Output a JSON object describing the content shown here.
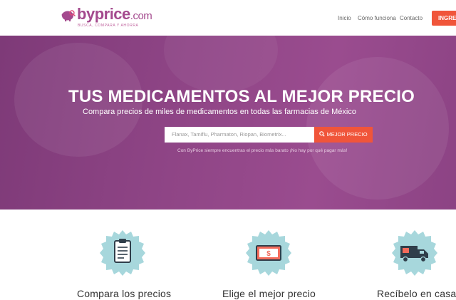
{
  "header": {
    "logo": {
      "by": "by",
      "price": "price",
      "com": ".com",
      "tagline": "BUSCA, COMPARA Y AHORRA"
    },
    "nav": [
      {
        "label": "Inicio"
      },
      {
        "label": "Cómo funciona"
      },
      {
        "label": "Contacto"
      }
    ],
    "cta_label": "INGRESA"
  },
  "hero": {
    "title": "TUS MEDICAMENTOS AL MEJOR PRECIO",
    "subtitle": "Compara precios de miles de medicamentos en todas las farmacias de México",
    "search_placeholder": "Flanax, Tamiflu, Pharmaton, Riopan, Biometrix...",
    "search_button": "MEJOR PRECIO",
    "note": "Con ByPrice siempre encuentras el precio más barato ¡No hay por qué pagar más!"
  },
  "features": [
    {
      "label": "Compara los precios",
      "icon": "clipboard-icon"
    },
    {
      "label": "Elige el mejor precio",
      "icon": "money-icon"
    },
    {
      "label": "Recíbelo en casa",
      "icon": "truck-icon"
    }
  ],
  "colors": {
    "brand_purple": "#8f4586",
    "accent_orange": "#f0553a",
    "badge_teal": "#a7d7dc"
  }
}
